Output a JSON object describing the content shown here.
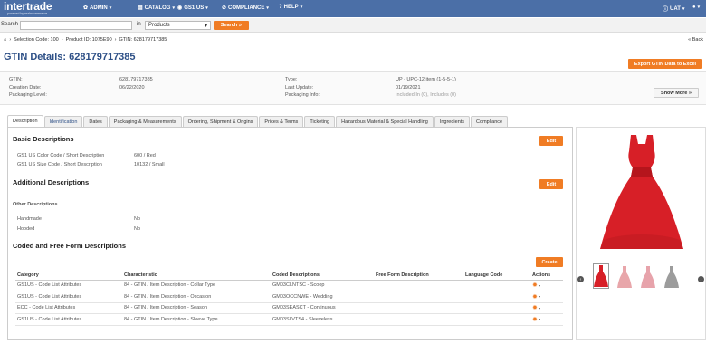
{
  "header": {
    "logo": "intertrade",
    "logo_sub": "powered by realmcommerce",
    "nav": [
      {
        "label": "ADMIN",
        "icon": "gear-icon"
      },
      {
        "label": "CATALOG",
        "icon": "book-icon"
      },
      {
        "label": "GS1 US",
        "icon": "globe-icon"
      },
      {
        "label": "COMPLIANCE",
        "icon": "check-circle-icon"
      },
      {
        "label": "HELP",
        "icon": "help-icon"
      }
    ],
    "user_label": "UAT",
    "user_icon": "info-icon",
    "profile_icon": "user-icon",
    "accent": "#4b6fa7"
  },
  "search": {
    "label": "Search",
    "placeholder": "",
    "in_label": "in",
    "scope": "Products",
    "button": "Search"
  },
  "breadcrumb": {
    "home_icon": "home-icon",
    "items": [
      "Selection Code: 100",
      "Product ID: 1075E90",
      "GTIN: 628179717385"
    ],
    "back": "« Back"
  },
  "page": {
    "title": "GTIN Details: 628179717385",
    "export_button": "Export GTIN Data to Excel",
    "brand_orange": "#f07c24"
  },
  "details": {
    "gtin_label": "GTIN:",
    "gtin_value": "628179717385",
    "creation_label": "Creation Date:",
    "creation_value": "06/22/2020",
    "packaging_level_label": "Packaging Level:",
    "packaging_level_value": "",
    "type_label": "Type:",
    "type_value": "UP - UPC-12 item (1-5-5-1)",
    "last_update_label": "Last Update:",
    "last_update_value": "01/19/2021",
    "packaging_info_label": "Packaging Info:",
    "packaging_info_value": "Included In (0), Includes (0)",
    "show_more": "Show More »"
  },
  "tabs": [
    "Description",
    "Identification",
    "Dates",
    "Packaging & Measurements",
    "Ordering, Shipment & Origins",
    "Prices & Terms",
    "Ticketing",
    "Hazardous Material & Special Handling",
    "Ingredients",
    "Compliance"
  ],
  "basic": {
    "title": "Basic Descriptions",
    "edit": "Edit",
    "rows": [
      {
        "label": "GS1 US Color Code / Short Description",
        "value": "600 / Red"
      },
      {
        "label": "GS1 US Size Code / Short Description",
        "value": "10132 / Small"
      }
    ]
  },
  "additional": {
    "title": "Additional Descriptions",
    "edit": "Edit",
    "subhead": "Other Descriptions",
    "rows": [
      {
        "label": "Handmade",
        "value": "No"
      },
      {
        "label": "Hooded",
        "value": "No"
      }
    ]
  },
  "coded": {
    "title": "Coded and Free Form Descriptions",
    "create": "Create",
    "columns": [
      "Category",
      "Characteristic",
      "Coded Descriptions",
      "Free Form Description",
      "Language Code",
      "Actions"
    ],
    "rows": [
      [
        "GS1US - Code List Attributes",
        "84 - GTIN / Item Description - Collar Type",
        "GM03CLNTSC - Scoop",
        "",
        ""
      ],
      [
        "GS1US - Code List Attributes",
        "84 - GTIN / Item Description - Occasion",
        "GM03OCCNWE - Wedding",
        "",
        ""
      ],
      [
        "ECC - Code List Attributes",
        "84 - GTIN / Item Description - Season",
        "GM03SEASCT - Continuous",
        "",
        ""
      ],
      [
        "GS1US - Code List Attributes",
        "84 - GTIN / Item Description - Sleeve Type",
        "GM03SLVTS4 - Sleeveless",
        "",
        ""
      ]
    ]
  },
  "gallery": {
    "thumb_colors": [
      "#d71f27",
      "#e8a6aa",
      "#e7a3ab",
      "#9c9c9c"
    ]
  }
}
